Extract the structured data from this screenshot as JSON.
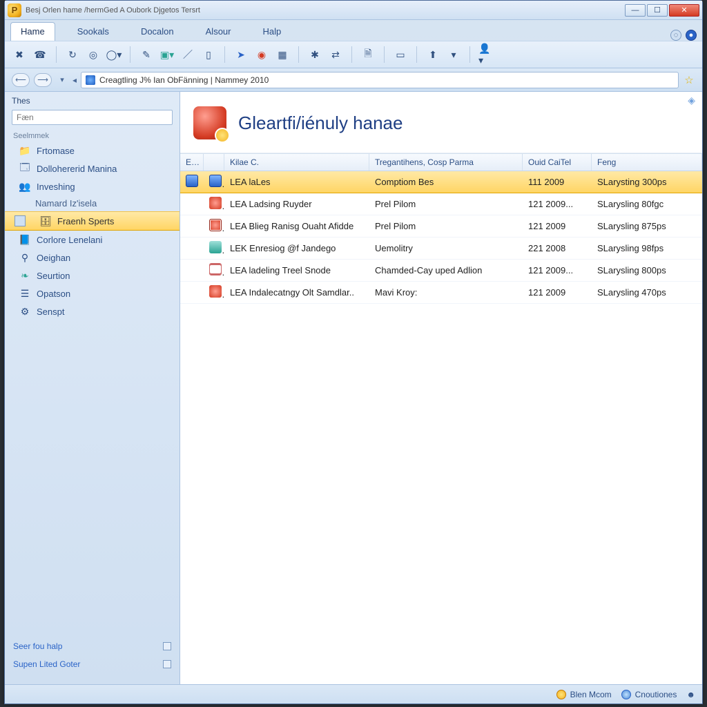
{
  "window": {
    "title": "Besj Orlen hame /hermGed A Oubork Djgetos Tersrt"
  },
  "menu": {
    "tabs": [
      "Hame",
      "Sookals",
      "Docalon",
      "Alsour",
      "Halp"
    ],
    "active_index": 0
  },
  "addressbar": {
    "text": "Creagtling J% Ian ObFänning | Nammey 2010"
  },
  "sidebar": {
    "header": "Thes",
    "filter_placeholder": "Fæn",
    "section_label": "Seelmmek",
    "items": [
      {
        "label": "Frtomase",
        "icon": "folder-icon"
      },
      {
        "label": "Dollohererid Manina",
        "icon": "page-icon"
      },
      {
        "label": "Inveshing",
        "icon": "people-icon"
      },
      {
        "label": "Namard Iz'isela",
        "icon": "",
        "sub": true
      },
      {
        "label": "Fraenh Sperts",
        "icon": "db-icon",
        "selected": true
      },
      {
        "label": "Corlore Lenelani",
        "icon": "book-icon"
      },
      {
        "label": "Oeighan",
        "icon": "wand-icon"
      },
      {
        "label": "Seurtion",
        "icon": "leaf-icon"
      },
      {
        "label": "Opatson",
        "icon": "list-icon"
      },
      {
        "label": "Senspt",
        "icon": "gear-icon"
      }
    ],
    "bottom_links": [
      "Seer fou halp",
      "Supen Lited Goter"
    ]
  },
  "main": {
    "title": "Gleartfi/iénuly hanae",
    "columns": {
      "ico": "Eet",
      "name": "Kilae C.",
      "desc": "Tregantihens, Cosp Parma",
      "date": "Ouid CaiTel",
      "feng": "Feng"
    },
    "rows": [
      {
        "name": "LEA laLes",
        "desc": "Comptiom Bes",
        "date": "111 2009",
        "feng": "SLarysting 300ps",
        "i1": "ri-blue",
        "i2": "ri-blue",
        "selected": true
      },
      {
        "name": "LEA Ladsing Ruyder",
        "desc": "Prel Pilom",
        "date": "121 2009...",
        "feng": "SLarysling 80fgc",
        "i1": "",
        "i2": "ri-red"
      },
      {
        "name": "LEA Blieg Ranisg Ouaht Afidde",
        "desc": "Prel Pilom",
        "date": "121 2009",
        "feng": "SLarysling 875ps",
        "i1": "",
        "i2": "ri-redb"
      },
      {
        "name": "LEK Enresiog @f Jandego",
        "desc": "Uemolitry",
        "date": "221 2008",
        "feng": "SLarysling 98fps",
        "i1": "",
        "i2": "ri-teal"
      },
      {
        "name": "LEA ladeling Treel Snode",
        "desc": "Chamded-Cay uped Adlion",
        "date": "121 2009...",
        "feng": "SLarysling 800ps",
        "i1": "",
        "i2": "ri-doc"
      },
      {
        "name": "LEA Indalecatngy Olt Samdlar..",
        "desc": "Mavi Kroy:",
        "date": "121 2009",
        "feng": "SLarysling 470ps",
        "i1": "",
        "i2": "ri-red"
      }
    ]
  },
  "statusbar": {
    "left": "Blen Mcom",
    "right": "Cnoutiones"
  }
}
